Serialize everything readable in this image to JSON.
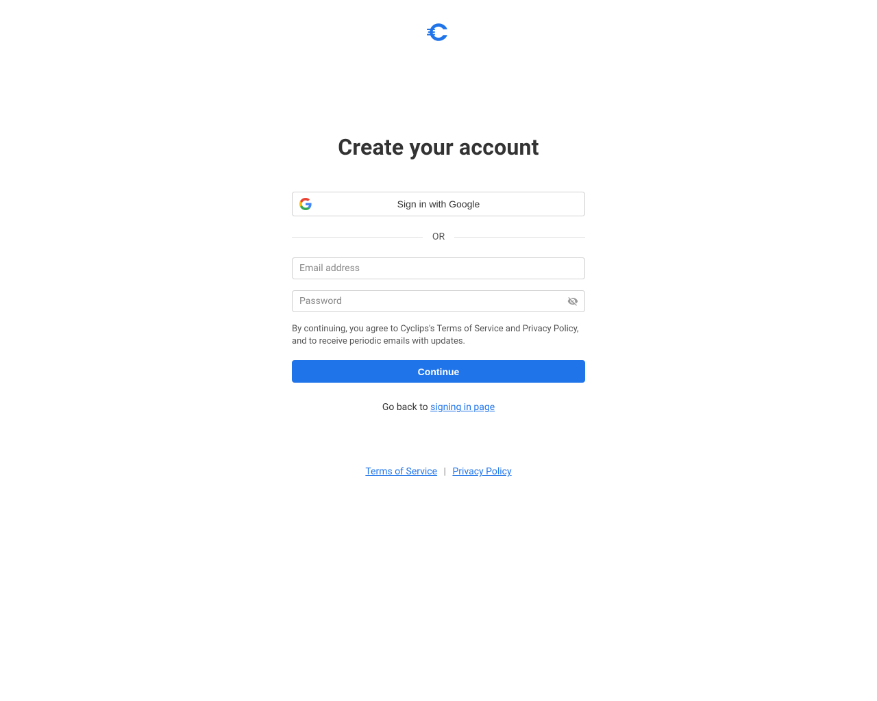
{
  "header": {
    "title": "Create your account"
  },
  "google_button": {
    "label": "Sign in with Google"
  },
  "divider": {
    "label": "OR"
  },
  "form": {
    "email_placeholder": "Email address",
    "password_placeholder": "Password",
    "terms_text": "By continuing, you agree to Cyclips's Terms of Service and Privacy Policy, and to receive periodic emails with updates.",
    "continue_label": "Continue"
  },
  "goback": {
    "prefix": "Go back to ",
    "link_label": "signing in page"
  },
  "footer": {
    "terms_label": "Terms of Service",
    "separator": "|",
    "privacy_label": "Privacy Policy"
  },
  "colors": {
    "primary": "#1f74ea"
  }
}
